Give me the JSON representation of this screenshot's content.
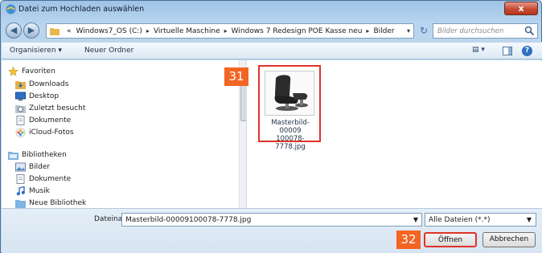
{
  "window": {
    "title": "Datei zum Hochladen auswählen",
    "close_glyph": "x"
  },
  "address_bar": {
    "overflow_glyph": "«",
    "crumbs": [
      "Windows7_OS (C:)",
      "Virtuelle Maschine",
      "Windows 7 Redesign POE Kasse neu",
      "Bilder"
    ],
    "separator": "▸",
    "dropdown_glyph": "▾",
    "refresh_glyph": "↻"
  },
  "search": {
    "placeholder": "Bilder durchsuchen"
  },
  "toolbar": {
    "organize": "Organisieren ▾",
    "new_folder": "Neuer Ordner",
    "view_glyph": "▤ ▾",
    "help_glyph": "?"
  },
  "nav": {
    "favorites_header": "Favoriten",
    "favorites": [
      "Downloads",
      "Desktop",
      "Zuletzt besucht",
      "Dokumente",
      "iCloud-Fotos"
    ],
    "libraries_header": "Bibliotheken",
    "libraries": [
      "Bilder",
      "Dokumente",
      "Musik",
      "Neue Bibliothek"
    ]
  },
  "files": [
    {
      "name": "Masterbild-00009100078-7778.jpg",
      "label_line1": "Masterbild-00009",
      "label_line2": "100078-7778.jpg"
    }
  ],
  "callouts": {
    "file": "31",
    "open": "32"
  },
  "bottom": {
    "filename_label": "Dateiname:",
    "filename_value": "Masterbild-00009100078-7778.jpg",
    "filetype": "Alle Dateien (*.*)",
    "open_label": "Öffnen",
    "cancel_label": "Abbrechen"
  },
  "colors": {
    "callout": "#f26522",
    "highlight": "#e0322a",
    "title_gradient": "#9fc3e6"
  }
}
